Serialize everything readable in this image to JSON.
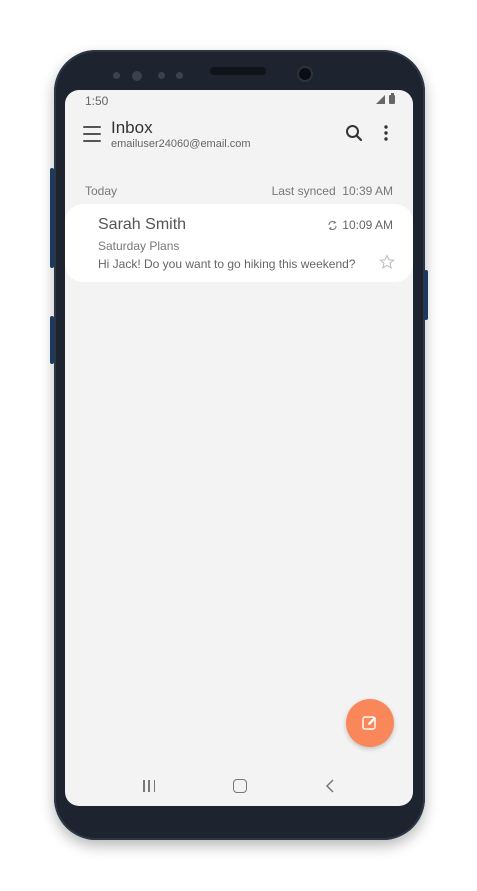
{
  "status_bar": {
    "time": "1:50"
  },
  "header": {
    "title": "Inbox",
    "account": "emailuser24060@email.com",
    "icons": [
      "menu-icon",
      "search-icon",
      "more-vert-icon"
    ]
  },
  "list": {
    "section_label": "Today",
    "sync_label": "Last synced",
    "sync_time": "10:39 AM"
  },
  "emails": [
    {
      "sender": "Sarah Smith",
      "time": "10:09 AM",
      "subject": "Saturday Plans",
      "preview": "Hi Jack! Do you want to go hiking this weekend?",
      "starred": false
    }
  ],
  "fab": {
    "icon": "compose-icon",
    "color": "#f9875a"
  },
  "nav": {
    "icons": [
      "recent-apps-icon",
      "home-icon",
      "back-icon"
    ]
  }
}
